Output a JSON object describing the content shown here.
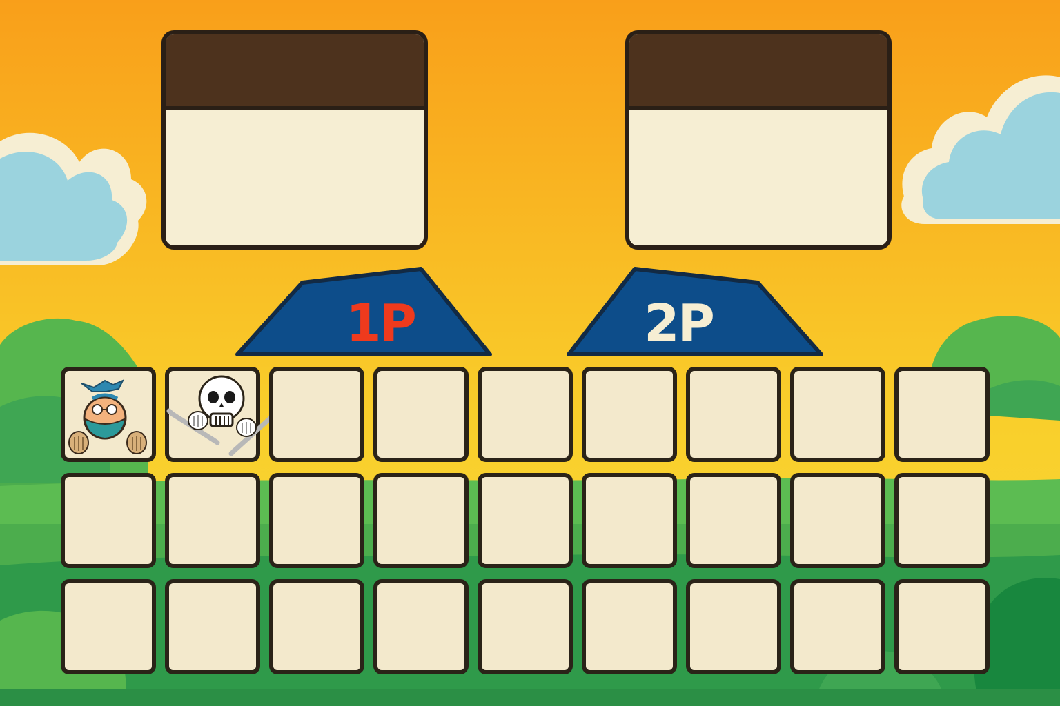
{
  "colors": {
    "sky_top": "#f9a21b",
    "sky_bottom": "#f9d431",
    "hills_light": "#57b84f",
    "hills_dark": "#2f9a4a",
    "panel_header": "#4d321d",
    "panel_body": "#f6eed3",
    "tag_fill": "#0d4d8a",
    "label_1p": "#ef3a1d",
    "label_2p": "#f6eed3",
    "slot_fill": "#f3e9cc"
  },
  "players": [
    {
      "id": "1p",
      "tag_label": "1P",
      "selected_character": ""
    },
    {
      "id": "2p",
      "tag_label": "2P",
      "selected_character": ""
    }
  ],
  "roster": {
    "rows": 3,
    "columns": 9,
    "slots": [
      {
        "icon": "pirate-sailor-icon"
      },
      {
        "icon": "skull-crossbones-icon"
      },
      {
        "icon": ""
      },
      {
        "icon": ""
      },
      {
        "icon": ""
      },
      {
        "icon": ""
      },
      {
        "icon": ""
      },
      {
        "icon": ""
      },
      {
        "icon": ""
      },
      {
        "icon": ""
      },
      {
        "icon": ""
      },
      {
        "icon": ""
      },
      {
        "icon": ""
      },
      {
        "icon": ""
      },
      {
        "icon": ""
      },
      {
        "icon": ""
      },
      {
        "icon": ""
      },
      {
        "icon": ""
      },
      {
        "icon": ""
      },
      {
        "icon": ""
      },
      {
        "icon": ""
      },
      {
        "icon": ""
      },
      {
        "icon": ""
      },
      {
        "icon": ""
      },
      {
        "icon": ""
      },
      {
        "icon": ""
      },
      {
        "icon": ""
      }
    ]
  }
}
